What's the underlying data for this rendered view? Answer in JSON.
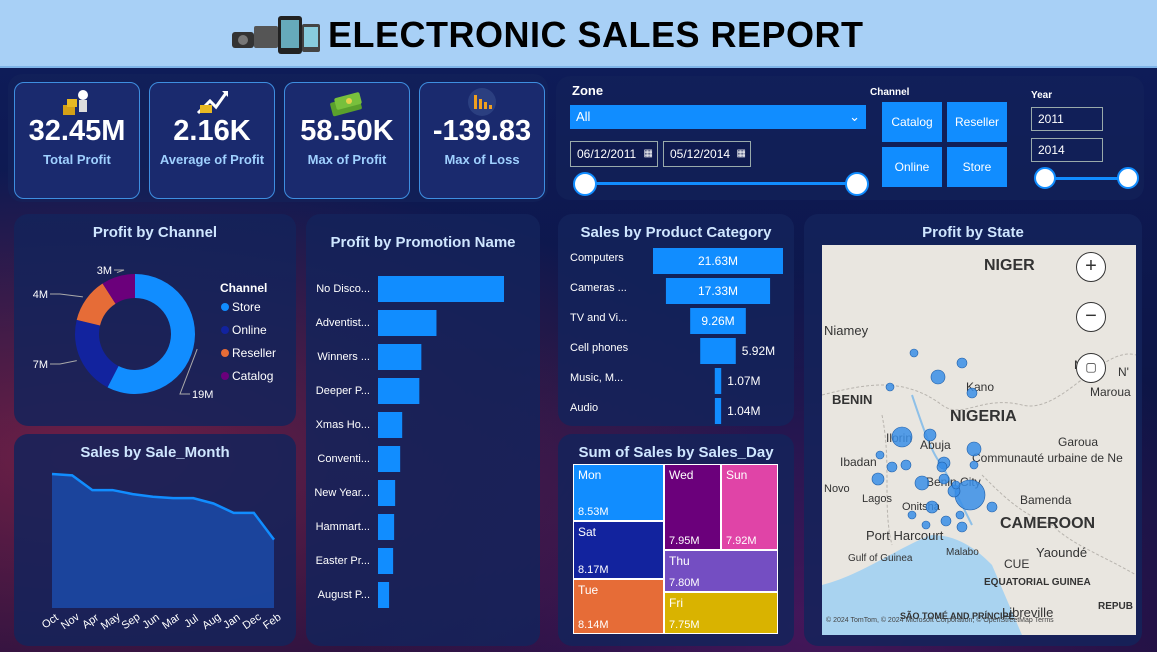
{
  "header": {
    "title": "ELECTRONIC SALES REPORT"
  },
  "kpis": [
    {
      "value": "32.45M",
      "label": "Total Profit",
      "icon": "money-man-icon"
    },
    {
      "value": "2.16K",
      "label": "Average of Profit",
      "icon": "cash-growth-icon"
    },
    {
      "value": "58.50K",
      "label": "Max of Profit",
      "icon": "money-stack-icon"
    },
    {
      "value": "-139.83",
      "label": "Max of Loss",
      "icon": "chart-decline-icon"
    }
  ],
  "filters": {
    "zone_label": "Zone",
    "zone_value": "All",
    "date_start": "06/12/2011",
    "date_end": "05/12/2014",
    "channel_label": "Channel",
    "channels": [
      "Catalog",
      "Reseller",
      "Online",
      "Store"
    ],
    "year_label": "Year",
    "year_start": "2011",
    "year_end": "2014"
  },
  "profit_by_channel": {
    "title": "Profit by Channel",
    "legend_title": "Channel",
    "colors": [
      "#118dff",
      "#12239e",
      "#e66c37",
      "#6b007b"
    ],
    "chart_data": {
      "type": "pie",
      "categories": [
        "Store",
        "Online",
        "Reseller",
        "Catalog"
      ],
      "values": [
        19,
        7,
        4,
        3
      ],
      "labels": [
        "19M",
        "7M",
        "4M",
        "3M"
      ]
    }
  },
  "profit_by_promotion": {
    "title": "Profit by Promotion Name",
    "chart_data": {
      "type": "bar",
      "categories": [
        "No Disco...",
        "Adventist...",
        "Winners ...",
        "Deeper P...",
        "Xmas Ho...",
        "Conventi...",
        "New Year...",
        "Hammart...",
        "Easter Pr...",
        "August P..."
      ],
      "values": [
        12.5,
        5.8,
        4.3,
        4.1,
        2.4,
        2.2,
        1.7,
        1.6,
        1.5,
        1.1
      ]
    }
  },
  "sales_by_category": {
    "title": "Sales by Product Category",
    "chart_data": {
      "type": "bar",
      "categories": [
        "Computers",
        "Cameras ...",
        "TV and Vi...",
        "Cell phones",
        "Music, M...",
        "Audio"
      ],
      "values": [
        21.63,
        17.33,
        9.26,
        5.92,
        1.07,
        1.04
      ],
      "labels": [
        "21.63M",
        "17.33M",
        "9.26M",
        "5.92M",
        "1.07M",
        "1.04M"
      ]
    }
  },
  "sales_by_month": {
    "title": "Sales by Sale_Month",
    "chart_data": {
      "type": "area",
      "categories": [
        "Oct",
        "Nov",
        "Apr",
        "May",
        "Sep",
        "Jun",
        "Mar",
        "Jul",
        "Aug",
        "Jan",
        "Dec",
        "Feb"
      ],
      "values": [
        100,
        99,
        88,
        88,
        85,
        83,
        82,
        82,
        78,
        71,
        71,
        51
      ]
    }
  },
  "sales_by_day": {
    "title": "Sum of Sales by Sales_Day",
    "chart_data": {
      "type": "heatmap",
      "categories": [
        "Mon",
        "Sat",
        "Tue",
        "Wed",
        "Sun",
        "Thu",
        "Fri"
      ],
      "values": [
        8.53,
        8.17,
        8.14,
        7.95,
        7.92,
        7.8,
        7.75
      ],
      "labels": [
        "8.53M",
        "8.17M",
        "8.14M",
        "7.95M",
        "7.92M",
        "7.80M",
        "7.75M"
      ],
      "colors": [
        "#118dff",
        "#12239e",
        "#e66c37",
        "#6b007b",
        "#e044a7",
        "#744ec2",
        "#d9b300"
      ]
    }
  },
  "profit_by_state": {
    "title": "Profit by State",
    "map_labels": [
      "NIGER",
      "Niamey",
      "BENIN",
      "NIGERIA",
      "Kano",
      "Abuja",
      "Ilorin",
      "Ibadan",
      "Novo",
      "Lagos",
      "Benin City",
      "Onitsha",
      "Port Harcourt",
      "Gulf of Guinea",
      "CAMEROON",
      "Bamenda",
      "Yaoundé",
      "Malabo",
      "EQUATORIAL GUINEA",
      "SÃO TOMÉ AND PRÍNCIPE",
      "Libreville",
      "Garoua",
      "Communauté urbaine de Ne",
      "CUE",
      "Maroua",
      "Maid",
      "N'",
      "REPUB"
    ],
    "attribution": "© 2024 TomTom, © 2024 Microsoft Corporation, © OpenStreetMap Terms",
    "zoom_in": "+",
    "zoom_out": "−"
  }
}
